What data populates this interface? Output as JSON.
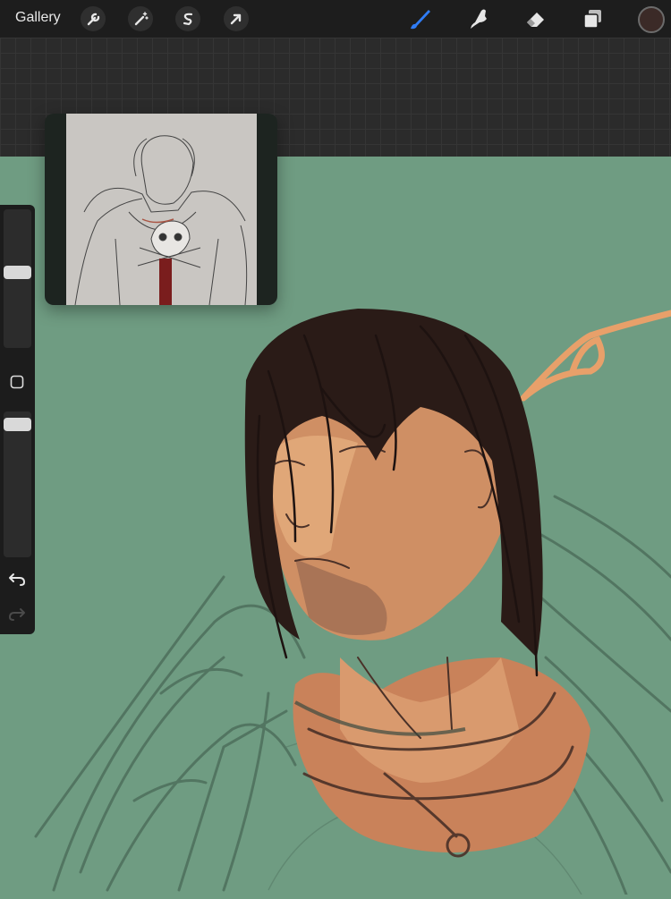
{
  "topbar": {
    "gallery_label": "Gallery",
    "left_tools": [
      {
        "name": "actions",
        "icon": "wrench-icon"
      },
      {
        "name": "adjustments",
        "icon": "magic-wand-icon"
      },
      {
        "name": "selection",
        "icon": "selection-s-icon"
      },
      {
        "name": "transform",
        "icon": "arrow-cursor-icon"
      }
    ],
    "right_tools": [
      {
        "name": "brush",
        "icon": "brush-icon",
        "active": true
      },
      {
        "name": "smudge",
        "icon": "smudge-finger-icon"
      },
      {
        "name": "eraser",
        "icon": "eraser-icon"
      },
      {
        "name": "layers",
        "icon": "layers-icon"
      }
    ],
    "current_color": "#3b2a27",
    "accent_color": "#2f7cf6"
  },
  "sidebar": {
    "brush_size": 0.55,
    "brush_opacity": 0.95,
    "icons": [
      "square-modifier-icon",
      "undo-icon",
      "redo-icon"
    ]
  },
  "canvas": {
    "background_color": "#6f9c82"
  }
}
